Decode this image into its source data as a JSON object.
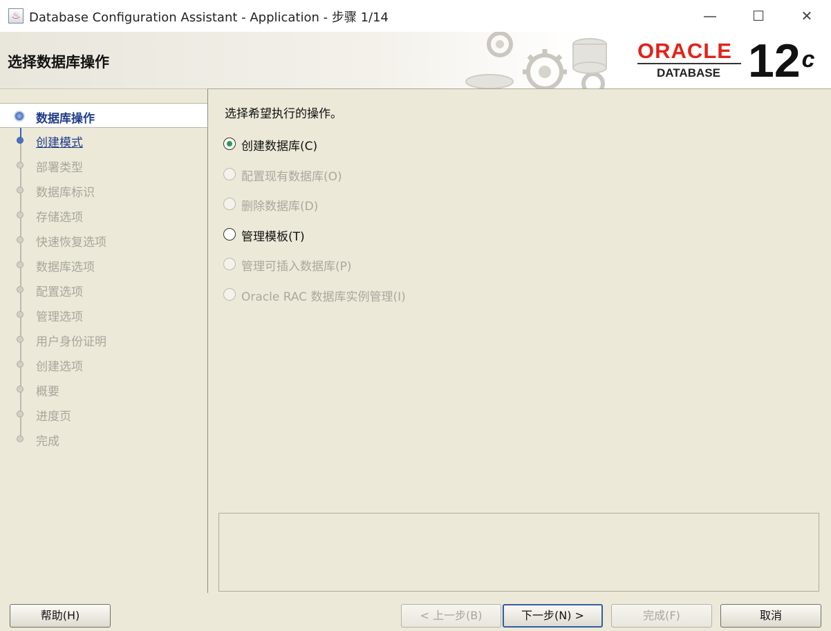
{
  "window": {
    "title": "Database Configuration Assistant - Application - 步骤 1/14",
    "minimize_glyph": "—",
    "maximize_glyph": "☐",
    "close_glyph": "✕"
  },
  "header": {
    "page_title": "选择数据库操作",
    "brand": "ORACLE",
    "brand_sub": "DATABASE",
    "version": "12",
    "version_suffix": "c",
    "brand_color": "#e2231a"
  },
  "sidebar": {
    "steps": [
      {
        "label": "数据库操作",
        "state": "active"
      },
      {
        "label": "创建模式",
        "state": "next"
      },
      {
        "label": "部署类型",
        "state": "disabled"
      },
      {
        "label": "数据库标识",
        "state": "disabled"
      },
      {
        "label": "存储选项",
        "state": "disabled"
      },
      {
        "label": "快速恢复选项",
        "state": "disabled"
      },
      {
        "label": "数据库选项",
        "state": "disabled"
      },
      {
        "label": "配置选项",
        "state": "disabled"
      },
      {
        "label": "管理选项",
        "state": "disabled"
      },
      {
        "label": "用户身份证明",
        "state": "disabled"
      },
      {
        "label": "创建选项",
        "state": "disabled"
      },
      {
        "label": "概要",
        "state": "disabled"
      },
      {
        "label": "进度页",
        "state": "disabled"
      },
      {
        "label": "完成",
        "state": "disabled"
      }
    ]
  },
  "main": {
    "instruction": "选择希望执行的操作。",
    "options": [
      {
        "label": "创建数据库(C)",
        "selected": true,
        "enabled": true
      },
      {
        "label": "配置现有数据库(O)",
        "selected": false,
        "enabled": false
      },
      {
        "label": "删除数据库(D)",
        "selected": false,
        "enabled": false
      },
      {
        "label": "管理模板(T)",
        "selected": false,
        "enabled": true
      },
      {
        "label": "管理可插入数据库(P)",
        "selected": false,
        "enabled": false
      },
      {
        "label": "Oracle RAC 数据库实例管理(I)",
        "selected": false,
        "enabled": false
      }
    ],
    "message": ""
  },
  "buttons": {
    "help": "帮助(H)",
    "back": "< 上一步(B)",
    "next": "下一步(N) >",
    "finish": "完成(F)",
    "cancel": "取消"
  }
}
